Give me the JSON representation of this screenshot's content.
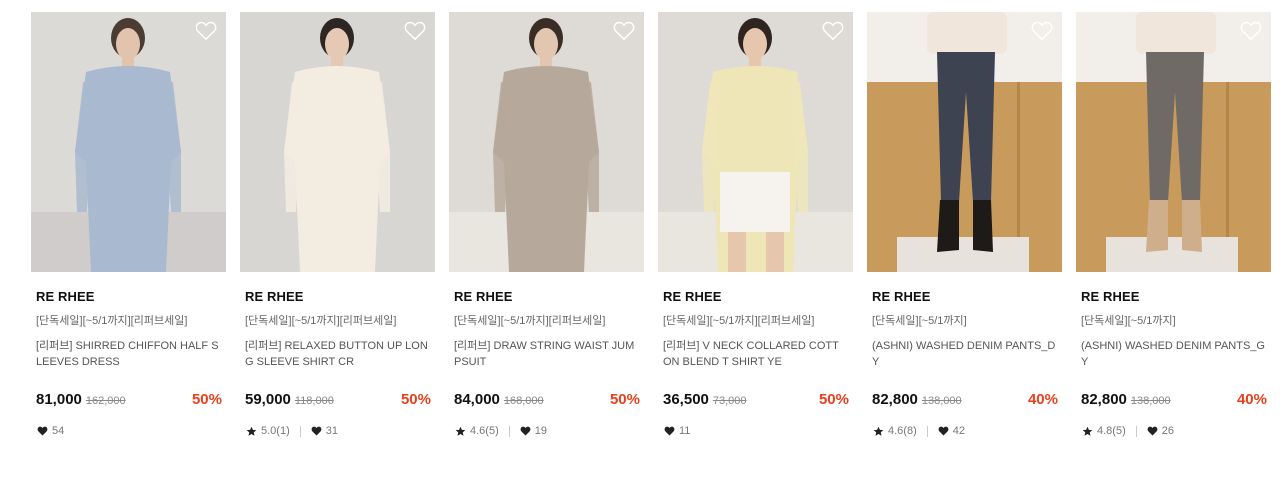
{
  "products": [
    {
      "brand": "RE RHEE",
      "tags": "[단독세일][~5/1까지][리퍼브세일]",
      "name": "[리퍼브] SHIRRED CHIFFON HALF SLEEVES DRESS",
      "price": "81,000",
      "original_price": "162,000",
      "discount": "50%",
      "rating": "",
      "likes": "54",
      "image": "model-blue-shirred-dress",
      "palette": {
        "bg": "#dcdad7",
        "cloth": "#a9b9cf",
        "skin": "#e2c4ae",
        "hair": "#4a3c33",
        "floor": "#cfcccb"
      }
    },
    {
      "brand": "RE RHEE",
      "tags": "[단독세일][~5/1까지][리퍼브세일]",
      "name": "[리퍼브] RELAXED BUTTON UP LONG SLEEVE SHIRT CR",
      "price": "59,000",
      "original_price": "118,000",
      "discount": "50%",
      "rating": "5.0(1)",
      "likes": "31",
      "image": "model-cream-shirt",
      "palette": {
        "bg": "#d8d6d3",
        "cloth": "#f3ece1",
        "skin": "#e6c9b4",
        "hair": "#2e2622",
        "floor": "#d8d6d3"
      }
    },
    {
      "brand": "RE RHEE",
      "tags": "[단독세일][~5/1까지][리퍼브세일]",
      "name": "[리퍼브] DRAW STRING WAIST JUMPSUIT",
      "price": "84,000",
      "original_price": "168,000",
      "discount": "50%",
      "rating": "4.6(5)",
      "likes": "19",
      "image": "model-beige-jumpsuit",
      "palette": {
        "bg": "#dedbd6",
        "cloth": "#b6a99b",
        "skin": "#e3c6b0",
        "hair": "#3a2d25",
        "floor": "#e9e5df"
      }
    },
    {
      "brand": "RE RHEE",
      "tags": "[단독세일][~5/1까지][리퍼브세일]",
      "name": "[리퍼브] V NECK COLLARED COTTON BLEND T SHIRT YE",
      "price": "36,500",
      "original_price": "73,000",
      "discount": "50%",
      "rating": "",
      "likes": "11",
      "image": "model-yellow-tshirt",
      "palette": {
        "bg": "#dedbd6",
        "cloth": "#efe6b8",
        "skin": "#e6c6ad",
        "hair": "#2f2520",
        "floor": "#e9e5df"
      }
    },
    {
      "brand": "RE RHEE",
      "tags": "[단독세일][~5/1까지]",
      "name": "(ASHNI) WASHED DENIM PANTS_DY",
      "price": "82,800",
      "original_price": "138,000",
      "discount": "40%",
      "rating": "4.6(8)",
      "likes": "42",
      "image": "legs-dark-denim-pants",
      "palette": {
        "bg": "#c89a5c",
        "cloth": "#3d4350",
        "skin": "#f0e6dc",
        "hair": "#1d1a18",
        "floor": "#e7e2db"
      }
    },
    {
      "brand": "RE RHEE",
      "tags": "[단독세일][~5/1까지]",
      "name": "(ASHNI) WASHED DENIM PANTS_GY",
      "price": "82,800",
      "original_price": "138,000",
      "discount": "40%",
      "rating": "4.8(5)",
      "likes": "26",
      "image": "legs-grey-denim-pants",
      "palette": {
        "bg": "#c89a5c",
        "cloth": "#6f6a66",
        "skin": "#f0e6dc",
        "hair": "#cfae8c",
        "floor": "#e7e2db"
      }
    }
  ],
  "colors": {
    "discount": "#e8411e",
    "text": "#111111"
  }
}
